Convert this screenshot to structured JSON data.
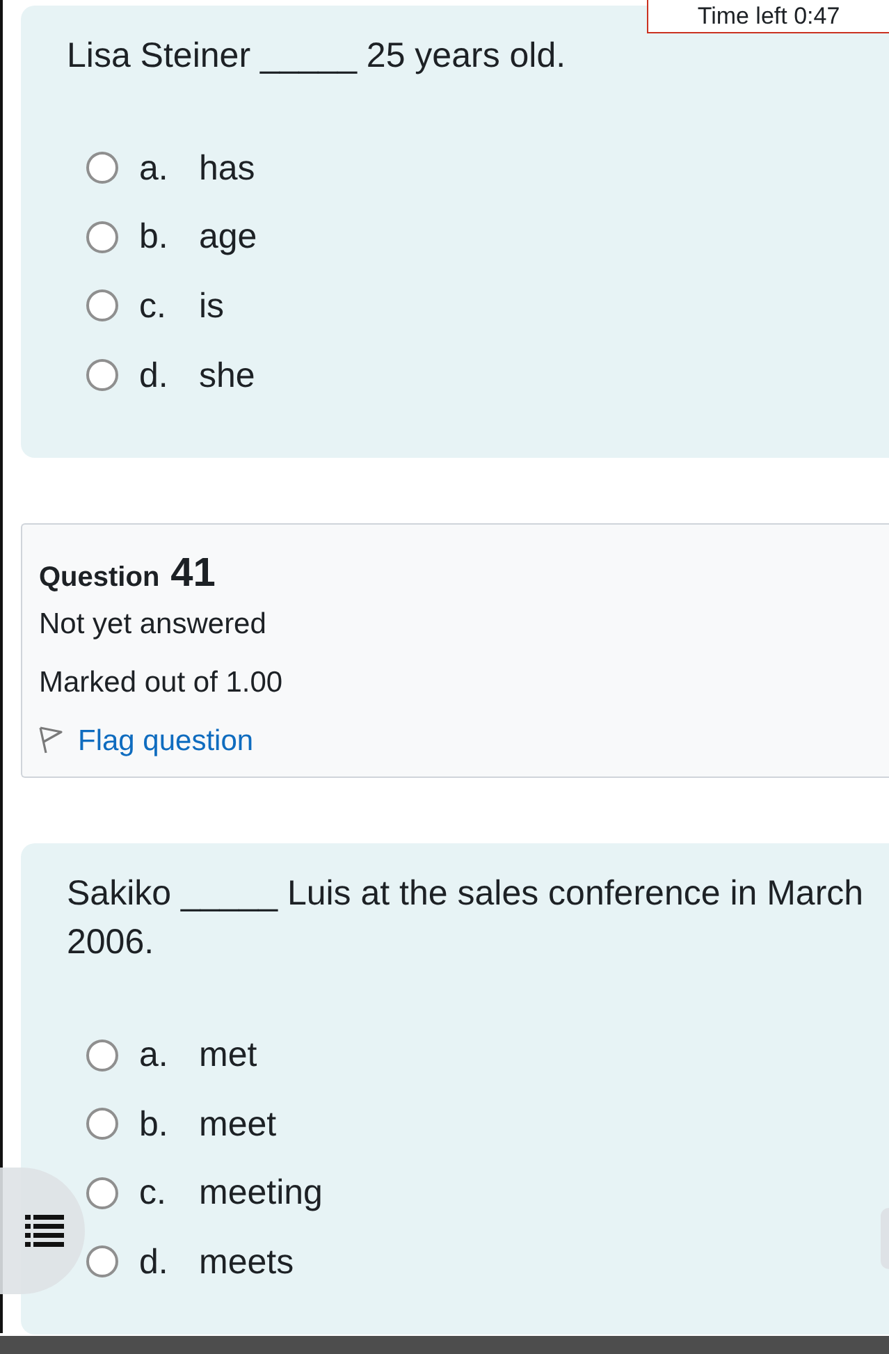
{
  "timer": {
    "label": "Time left 0:47"
  },
  "previous_question": {
    "text": "Lisa Steiner _____ 25 years old.",
    "options": [
      {
        "letter": "a.",
        "text": "has",
        "selected": false
      },
      {
        "letter": "b.",
        "text": "age",
        "selected": false
      },
      {
        "letter": "c.",
        "text": "is",
        "selected": false
      },
      {
        "letter": "d.",
        "text": "she",
        "selected": false
      }
    ]
  },
  "question_info": {
    "label": "Question",
    "number": "41",
    "status": "Not yet answered",
    "marks": "Marked out of 1.00",
    "flag_link": "Flag question"
  },
  "current_question": {
    "text": "Sakiko _____ Luis at the sales conference in March 2006.",
    "options": [
      {
        "letter": "a.",
        "text": "met",
        "selected": false
      },
      {
        "letter": "b.",
        "text": "meet",
        "selected": false
      },
      {
        "letter": "c.",
        "text": "meeting",
        "selected": false
      },
      {
        "letter": "d.",
        "text": "meets",
        "selected": false
      }
    ]
  }
}
